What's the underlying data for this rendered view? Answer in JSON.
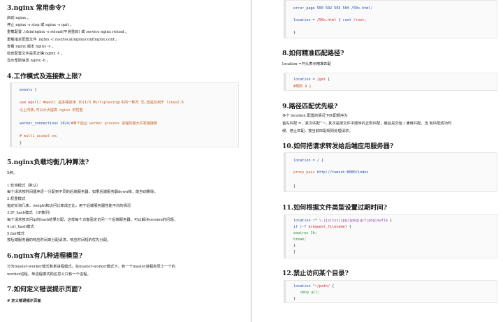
{
  "left": {
    "s3": {
      "title": "3.nginx 常用命令?",
      "lines": [
        "启动 nginx 。",
        "停止 nginx -s stop 或 nginx -s quit 。",
        "重载配置 ./sbin/nginx -s reload(平滑重启) 或 service nginx reload 。",
        "重载指定配置文件 .nginx -c /usr/local/nginx/conf/nginx.conf 。",
        "查看 nginx 版本 nginx -v 。",
        "检查配置文件是否正确 nginx -t 。",
        "显示帮助信息 nginx -h 。"
      ]
    },
    "s4": {
      "title": "4.工作模式及连接数上限?",
      "code": {
        "l1": "events {",
        "l2a": "use epoll;",
        "l2b": "#epoll 是多路复用 IO(I/O Multiplexing)中的一种方 式,但是仅用于 linux2.6",
        "l3": "以上内核,可以大大提高 nginx 的性能",
        "l4a": "worker_connections 1024;",
        "l4b": "#单个后台 worker process 进程的最大并发链接数",
        "l5": "# multi_accept on;",
        "l6": "}"
      }
    },
    "s5": {
      "title": "5.nginx负载均衡几种算法?",
      "lines": [
        "5种。",
        "1.轮询模式（默认）",
        "每个请求按时间顺序逐一分配到不同的后端服务器，如果后端服务器down掉，能自动剔除。",
        "2.权重模式",
        "指定轮询几率，weight和访问比率成正比，用于后端服务器性能不均的情况",
        "3.IP_hash模式 （IP散列）",
        "每个请求按访问ip的hash结果分配，这样每个访客固定访问一个后端服务器，可以解决session的问题。",
        "4.url_hash模式",
        "5.fair模式",
        "按后端服务器的响应时间来分配请求，响应时间短的优先分配。"
      ]
    },
    "s6": {
      "title": "6.nginx有几种进程模型?",
      "lines": [
        "分为master-worker模式和单进程模式。在master-worker模式下，有一个master进程和至少一个的",
        "worker进程，单进程模式顾名思义只有一个进程。"
      ]
    },
    "s7": {
      "title": "7.如何定义错误提示页面?",
      "lines": [
        "# 定义错误提示页面"
      ]
    }
  },
  "right": {
    "s7code": {
      "l1": "error_page 500 502 503 504 /50x.html;",
      "l2a": "location = ",
      "l2b": "/50x.html",
      "l2c": " { ",
      "l2d": "root",
      "l2e": " /root;",
      "l3": "}"
    },
    "s8": {
      "title": "8.如何精准匹配路径?",
      "lines": [
        "location =开头表示精准匹配"
      ],
      "code": {
        "l1a": "location = ",
        "l1b": "/get",
        "l1c": " {",
        "l2": "#规则 A }"
      }
    },
    "s9": {
      "title": "9.路径匹配优先级?",
      "lines": [
        "多个 location 配置的情况下匹配顺序为",
        "首先匹配 =，其次匹配^~, 其次是按文件中顺序的正则匹配，最后是交给 / 通用匹配。当 有匹配成功时",
        "候，停止匹配，按当前匹配规则处理请求。"
      ]
    },
    "s10": {
      "title": "10.如何把请求转发给后端应用服务器?",
      "code": {
        "l1": "location = / {",
        "l2a": "proxy_pass",
        "l2b": " http://tomcat:8080/index",
        "l3": "}"
      }
    },
    "s11": {
      "title": "11.如何根据文件类型设置过期时间?",
      "code": {
        "l1a": "location ~* ",
        "l1b": "\\.(js|css|jpg|jpeg|gif|png|swf)$",
        "l1c": " {",
        "l2a": "if (-f ",
        "l2b": "$request_filename",
        "l2c": ") {",
        "l3": "expires 1h;",
        "l4": "break;",
        "l5": "}",
        "l6": "}"
      }
    },
    "s12": {
      "title": "12.禁止访问某个目录?",
      "code": {
        "l1a": "location ",
        "l1b": "^~/path/",
        "l1c": " {",
        "l2": "deny all;",
        "l3": "}"
      }
    }
  }
}
